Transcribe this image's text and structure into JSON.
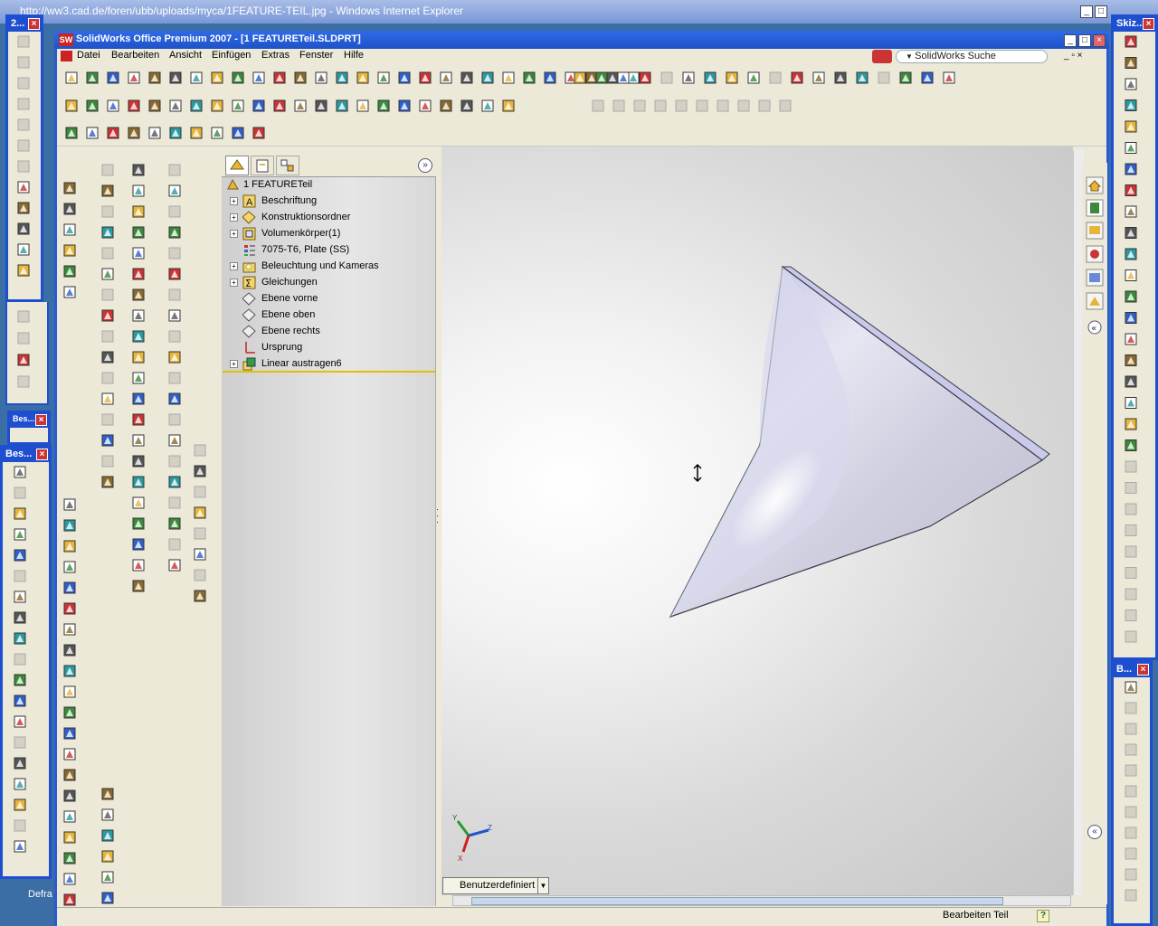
{
  "ie": {
    "title": "http://ww3.cad.de/foren/ubb/uploads/myca/1FEATURE-TEIL.jpg - Windows Internet Explorer"
  },
  "sw": {
    "title": "SolidWorks Office Premium 2007 - [1 FEATURETeil.SLDPRT]",
    "menu": [
      "Datei",
      "Bearbeiten",
      "Ansicht",
      "Einfügen",
      "Extras",
      "Fenster",
      "Hilfe"
    ],
    "search_label": "SolidWorks Suche"
  },
  "left_floats": {
    "top_title": "2...",
    "mid_title": "Bes...",
    "tiny_title": "Bes...",
    "taskbar_text": "Defra"
  },
  "right_floats": {
    "top_title": "Skiz...",
    "bottom_title": "B..."
  },
  "tree": {
    "items": [
      {
        "label": "1 FEATURETeil",
        "expand": false,
        "icon": "part-icon"
      },
      {
        "label": "Beschriftung",
        "expand": true,
        "icon": "annotation-icon"
      },
      {
        "label": "Konstruktionsordner",
        "expand": true,
        "icon": "design-folder-icon"
      },
      {
        "label": "Volumenkörper(1)",
        "expand": true,
        "icon": "solid-bodies-icon"
      },
      {
        "label": "7075-T6, Plate (SS)",
        "expand": false,
        "icon": "material-icon"
      },
      {
        "label": "Beleuchtung und Kameras",
        "expand": true,
        "icon": "lights-icon"
      },
      {
        "label": "Gleichungen",
        "expand": true,
        "icon": "equations-icon"
      },
      {
        "label": "Ebene vorne",
        "expand": false,
        "icon": "plane-icon"
      },
      {
        "label": "Ebene oben",
        "expand": false,
        "icon": "plane-icon"
      },
      {
        "label": "Ebene rechts",
        "expand": false,
        "icon": "plane-icon"
      },
      {
        "label": "Ursprung",
        "expand": false,
        "icon": "origin-icon"
      },
      {
        "label": "Linear austragen6",
        "expand": true,
        "icon": "extrude-icon"
      }
    ]
  },
  "viewport": {
    "view_orientation": "Benutzerdefiniert",
    "triad": {
      "x": "X",
      "y": "Y",
      "z": "Z"
    }
  },
  "status": {
    "text": "Bearbeiten Teil",
    "help": "?"
  },
  "colors": {
    "title_blue": "#1f4fd1",
    "model_face": "#d9d9ea",
    "model_edge": "#3a3a4a"
  }
}
